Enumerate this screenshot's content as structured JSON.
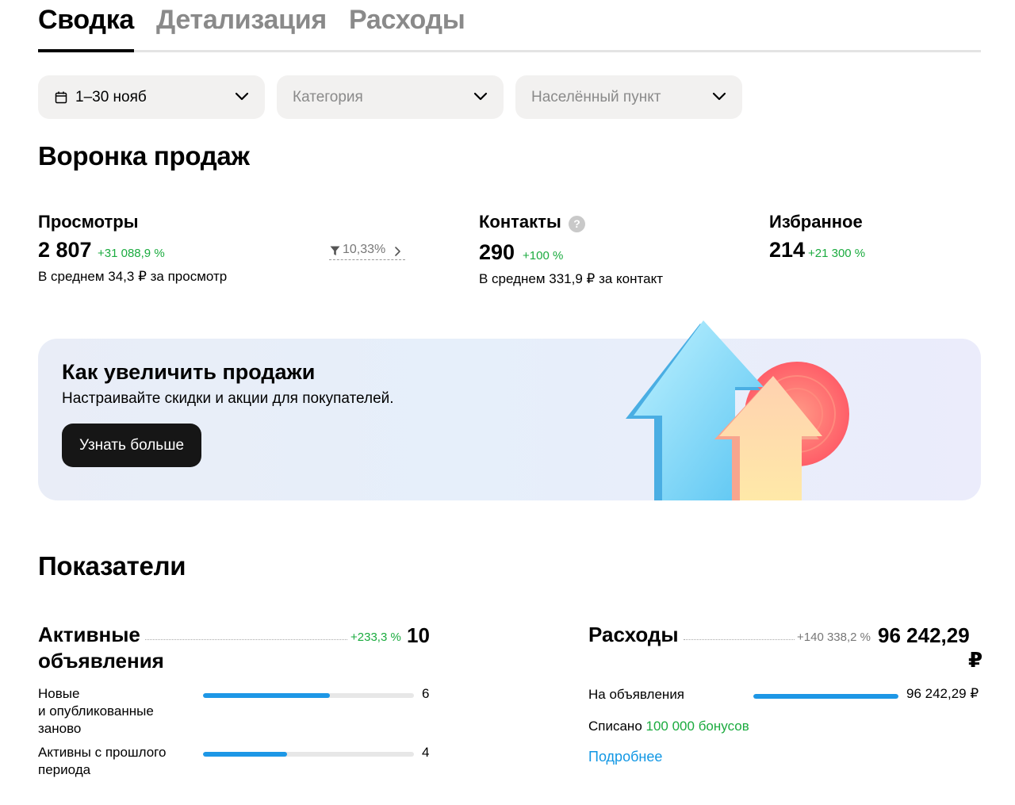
{
  "tabs": [
    {
      "label": "Сводка",
      "active": true
    },
    {
      "label": "Детализация",
      "active": false
    },
    {
      "label": "Расходы",
      "active": false
    }
  ],
  "filters": {
    "period": {
      "value": "1–30 нояб",
      "icon": "calendar-icon"
    },
    "category": {
      "placeholder": "Категория"
    },
    "locality": {
      "placeholder": "Населённый пункт"
    }
  },
  "funnel": {
    "title": "Воронка продаж",
    "views": {
      "label": "Просмотры",
      "value": "2 807",
      "delta": "+31 088,9 %",
      "sub": "В среднем 34,3 ₽ за просмотр",
      "conversion": "10,33%"
    },
    "contacts": {
      "label": "Контакты",
      "help": "?",
      "value": "290",
      "delta": "+100 %",
      "sub": "В среднем 331,9 ₽ за контакт"
    },
    "favorites": {
      "label": "Избранное",
      "value": "214",
      "delta": "+21 300 %"
    }
  },
  "promo": {
    "title": "Как увеличить продажи",
    "text": "Настраивайте скидки и акции для покупателей.",
    "button": "Узнать больше"
  },
  "indicators": {
    "title": "Показатели",
    "active_ads": {
      "title_line1": "Активные",
      "title_line2": "объявления",
      "delta": "+233,3 %",
      "value": "10",
      "rows": [
        {
          "label_lines": [
            "Новые",
            "и опубликованные",
            "заново"
          ],
          "value": "6",
          "fraction": 0.6
        },
        {
          "label_lines": [
            "Активны с прошлого",
            "периода"
          ],
          "value": "4",
          "fraction": 0.4
        }
      ]
    },
    "expenses": {
      "title": "Расходы",
      "delta": "+140 338,2 %",
      "value_line1": "96 242,29",
      "value_line2": "₽",
      "rows": [
        {
          "label": "На объявления",
          "value": "96 242,29 ₽",
          "fraction": 1.0
        }
      ],
      "bonus_prefix": "Списано",
      "bonus_value": "100 000 бонусов",
      "details_link": "Подробнее"
    }
  },
  "colors": {
    "positive": "#1bab3f",
    "bar": "#1d97e6",
    "link": "#1197e4",
    "button": "#161616"
  }
}
